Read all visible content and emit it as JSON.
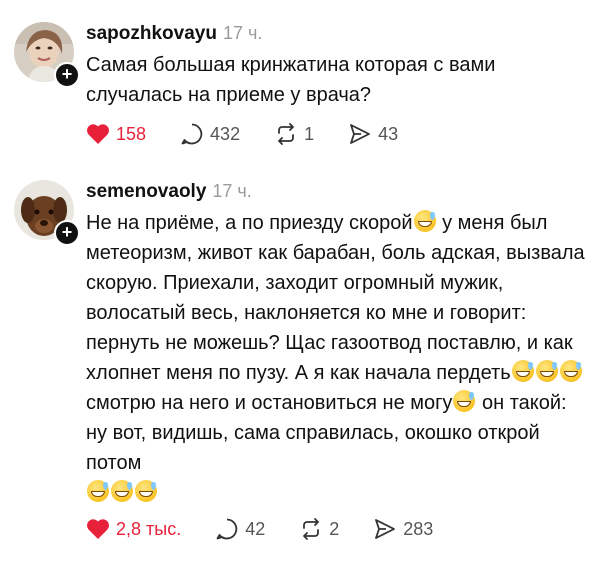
{
  "posts": [
    {
      "username": "sapozhkovayu",
      "time": "17 ч.",
      "text_parts": [
        "Самая большая кринжатина которая с вами случалась на приеме у врача?"
      ],
      "likes": "158",
      "replies": "432",
      "reposts": "1",
      "shares": "43"
    },
    {
      "username": "semenovaoly",
      "time": "17 ч.",
      "text_parts": [
        "Не на приёме,  а по приезду скорой",
        " у меня был метеоризм, живот как барабан, боль адская, вызвала скорую.  Приехали,  заходит огромный мужик, волосатый весь, наклоняется ко мне и говорит: пернуть не можешь? Щас газоотвод поставлю, и как хлопнет меня по пузу. А я как начала пердеть",
        " смотрю на него и остановиться не могу",
        " он такой: ну вот, видишь, сама справилась, окошко открой потом"
      ],
      "likes": "2,8 тыс.",
      "replies": "42",
      "reposts": "2",
      "shares": "283"
    }
  ],
  "icons": {
    "like": "heart-icon",
    "reply": "comment-icon",
    "repost": "repost-icon",
    "share": "share-icon",
    "emoji": "grinning-face-with-sweat-emoji"
  },
  "colors": {
    "like": "#e8213a",
    "text": "#111111",
    "muted": "#9a9a9a"
  }
}
